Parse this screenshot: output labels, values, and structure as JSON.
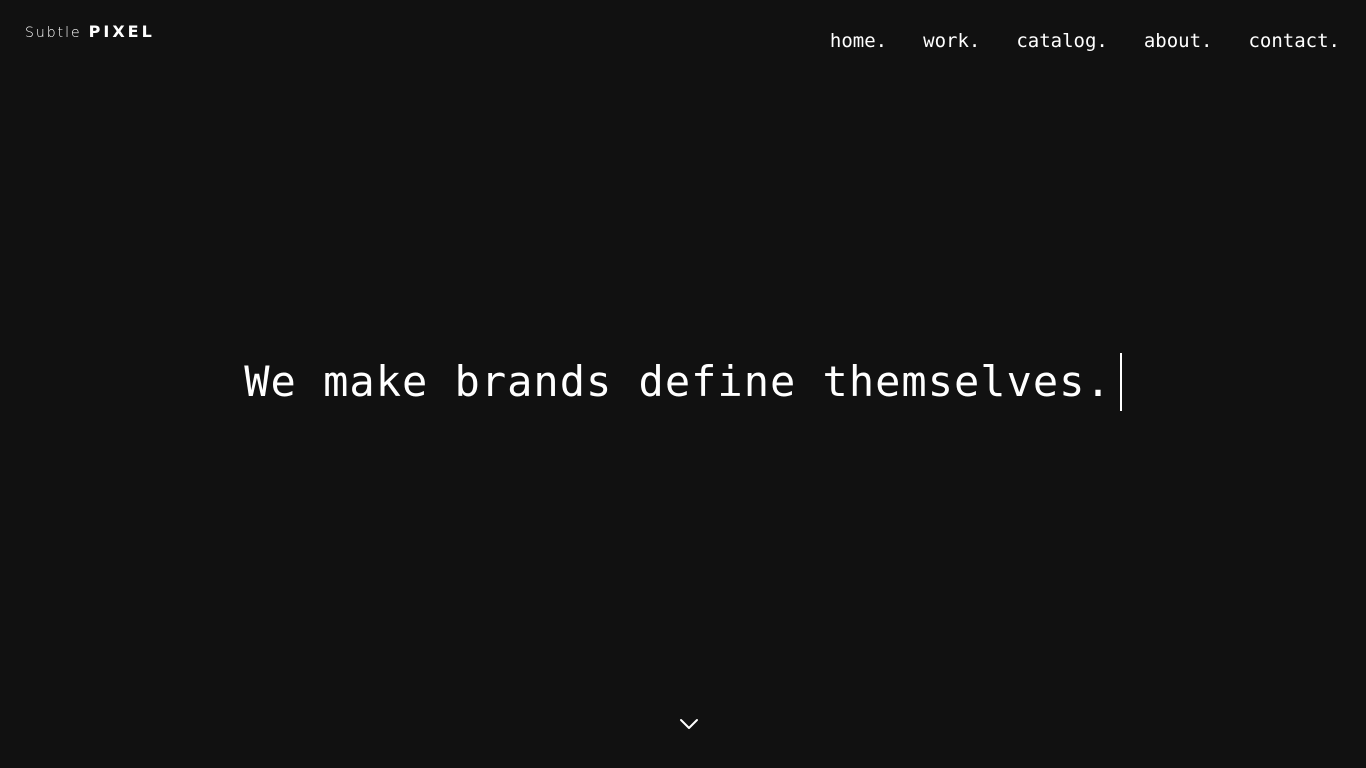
{
  "logo": {
    "subtle": "Subtle",
    "pixel": "PIXEL"
  },
  "nav": {
    "items": [
      {
        "label": "home."
      },
      {
        "label": "work."
      },
      {
        "label": "catalog."
      },
      {
        "label": "about."
      },
      {
        "label": "contact."
      }
    ]
  },
  "hero": {
    "headline": "We make brands define themselves."
  },
  "icons": {
    "scroll": "chevron-down-icon"
  },
  "colors": {
    "background": "#111111",
    "text": "#ffffff"
  }
}
